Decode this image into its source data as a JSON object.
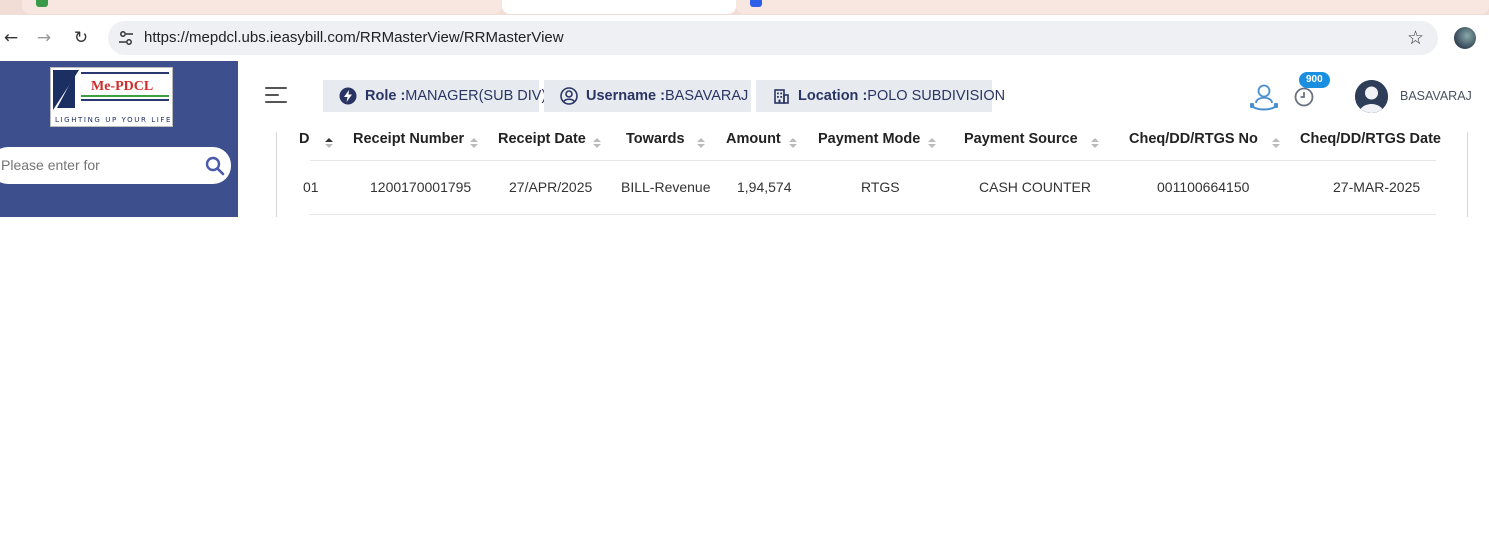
{
  "browser": {
    "url": "https://mepdcl.ubs.ieasybill.com/RRMasterView/RRMasterView"
  },
  "header": {
    "role_label": "Role :",
    "role_value": "MANAGER(SUB DIV)",
    "username_label": "Username :",
    "username_value": "BASAVARAJ",
    "location_label": "Location :",
    "location_value": "POLO SUBDIVISION",
    "notification_count": "900",
    "user_name": "BASAVARAJ"
  },
  "sidebar": {
    "logo_brand": "Me-PDCL",
    "logo_tagline": "LIGHTING UP YOUR LIFE",
    "search_placeholder": "Please enter for"
  },
  "table": {
    "columns": [
      "Receipt Number",
      "Receipt Date",
      "Towards",
      "Amount",
      "Payment Mode",
      "Payment Source",
      "Cheq/DD/RTGS No",
      "Cheq/DD/RTGS Date"
    ],
    "partial_first_header": "D",
    "partial_first_cell": "01",
    "rows": [
      [
        "1200170001795",
        "27/APR/2025",
        "BILL-Revenue",
        "1,94,574",
        "RTGS",
        "CASH COUNTER",
        "001100664150",
        "27-MAR-2025"
      ]
    ]
  },
  "colors": {
    "sidebar_bg": "#3d4f8d",
    "chip_bg": "#e7ebf0",
    "badge": "#1a8fe0"
  }
}
